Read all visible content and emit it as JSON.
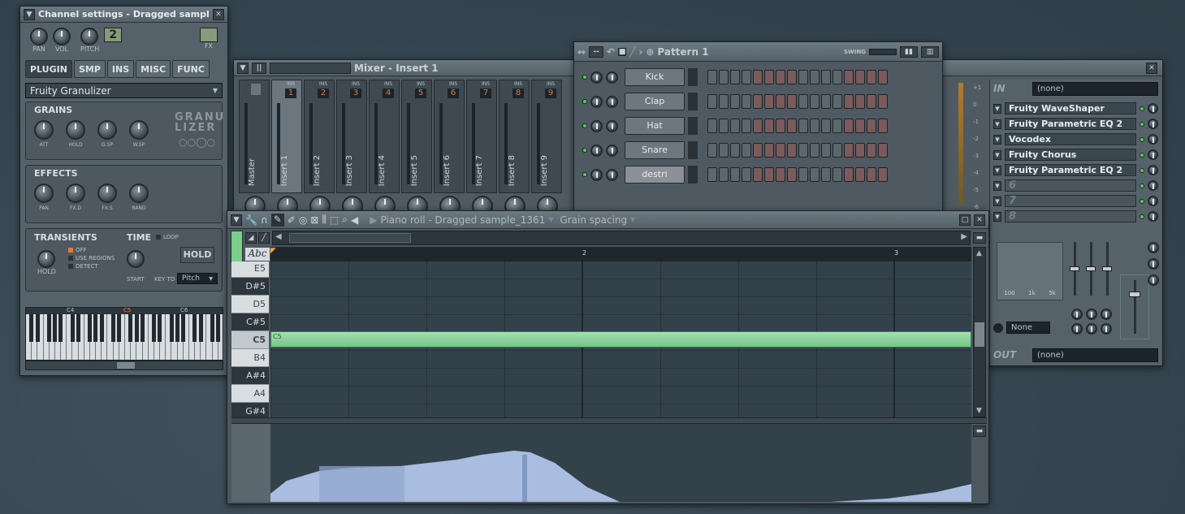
{
  "channel": {
    "title": "Channel settings - Dragged sample_...",
    "pitch_value": "2",
    "knob_labels": [
      "PAN",
      "VOL",
      "PITCH"
    ],
    "fx_label": "FX",
    "tabs": [
      "PLUGIN",
      "SMP",
      "INS",
      "MISC",
      "FUNC"
    ],
    "plugin_name": "Fruity Granulizer",
    "grains_label": "GRAINS",
    "grains_knobs": [
      "ATT",
      "HOLD",
      "G.SP",
      "W.SP"
    ],
    "logo_text": "GRANU LIZER",
    "effects_label": "EFFECTS",
    "effects_knobs": [
      "PAN",
      "FX.D",
      "FX.S",
      "RAND"
    ],
    "transients_label": "TRANSIENTS",
    "transients_opts": [
      "OFF",
      "USE REGIONS",
      "DETECT"
    ],
    "hold_knob": "HOLD",
    "time_label": "TIME",
    "loop_label": "LOOP",
    "hold_btn": "HOLD",
    "start_label": "START",
    "keyto_label": "KEY TO",
    "pitch_select": "Pitch",
    "octave_labels": [
      "C4",
      "C5",
      "C6"
    ]
  },
  "mixer": {
    "title": "Mixer - Insert 1",
    "inserts": [
      "Master",
      "Insert 1",
      "Insert 2",
      "Insert 3",
      "Insert 4",
      "Insert 5",
      "Insert 6",
      "Insert 7",
      "Insert 8",
      "Insert 9"
    ],
    "numbers": [
      "",
      "1",
      "2",
      "3",
      "4",
      "5",
      "6",
      "7",
      "8",
      "9"
    ],
    "ins_badge": "INS",
    "in_label": "IN",
    "in_value": "(none)",
    "fx_slots": [
      "Fruity WaveShaper",
      "Fruity Parametric EQ 2",
      "Vocodex",
      "Fruity Chorus",
      "Fruity Parametric EQ 2"
    ],
    "empty_slots": [
      "6",
      "7",
      "8"
    ],
    "eq_freqs": [
      "100",
      "1k",
      "5k"
    ],
    "none_label": "None",
    "out_label": "OUT",
    "out_value": "(none)"
  },
  "pattern": {
    "title": "Pattern 1",
    "swing_label": "SWING",
    "channels": [
      "Kick",
      "Clap",
      "Hat",
      "Snare",
      "destri"
    ]
  },
  "pianoroll": {
    "title": "Piano roll - Dragged sample_1361",
    "grain": "Grain spacing",
    "abc": "Abc",
    "bars": [
      "2",
      "3"
    ],
    "keys": [
      "E5",
      "D#5",
      "D5",
      "C#5",
      "C5",
      "B4",
      "A#4",
      "A4",
      "G#4"
    ],
    "note_label": "C5"
  }
}
